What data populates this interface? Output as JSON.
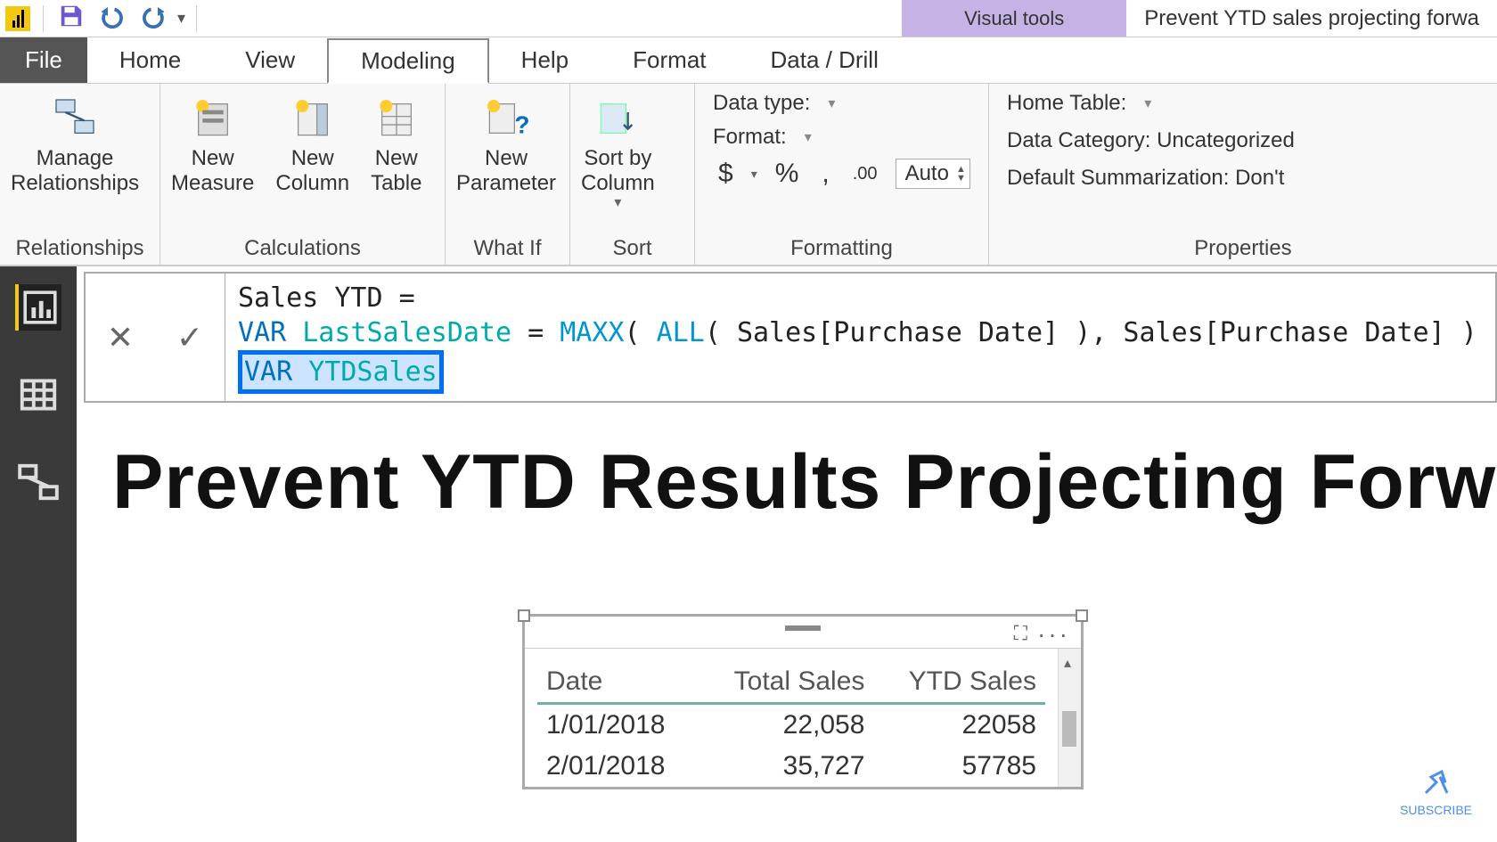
{
  "window_title": "Prevent YTD sales projecting forwa",
  "contextual_tab": "Visual tools",
  "tabs": {
    "file": "File",
    "home": "Home",
    "view": "View",
    "modeling": "Modeling",
    "help": "Help",
    "format": "Format",
    "data_drill": "Data / Drill"
  },
  "ribbon": {
    "relationships_group": "Relationships",
    "manage_relationships": "Manage\nRelationships",
    "calculations_group": "Calculations",
    "new_measure": "New\nMeasure",
    "new_column": "New\nColumn",
    "new_table": "New\nTable",
    "whatif_group": "What If",
    "new_parameter": "New\nParameter",
    "sort_group": "Sort",
    "sort_by_column": "Sort by\nColumn",
    "formatting_group": "Formatting",
    "data_type": "Data type:",
    "format_label": "Format:",
    "currency_sym": "$",
    "percent_sym": "%",
    "comma_sym": ",",
    "decimal_sym": ".00",
    "auto": "Auto",
    "properties_group": "Properties",
    "home_table": "Home Table:",
    "data_category": "Data Category: Uncategorized",
    "default_summarization": "Default Summarization: Don't"
  },
  "formula": {
    "line1_name": "Sales YTD",
    "line1_eq": " = ",
    "var_kw": "VAR",
    "last_sales_var": " LastSalesDate",
    "eq2": " = ",
    "maxx": "MAXX",
    "paren1": "( ",
    "all": "ALL",
    "paren2": "( ",
    "col1": "Sales[Purchase Date]",
    "paren3": " ), ",
    "col2": "Sales[Purchase Date]",
    "paren4": " )",
    "ytd_var": " YTDSales"
  },
  "page_heading": "Prevent YTD Results Projecting Forw",
  "table": {
    "headers": [
      "Date",
      "Total Sales",
      "YTD Sales"
    ],
    "rows": [
      {
        "date": "1/01/2018",
        "total": "22,058",
        "ytd": "22058"
      },
      {
        "date": "2/01/2018",
        "total": "35,727",
        "ytd": "57785"
      }
    ]
  },
  "subscribe": "SUBSCRIBE"
}
